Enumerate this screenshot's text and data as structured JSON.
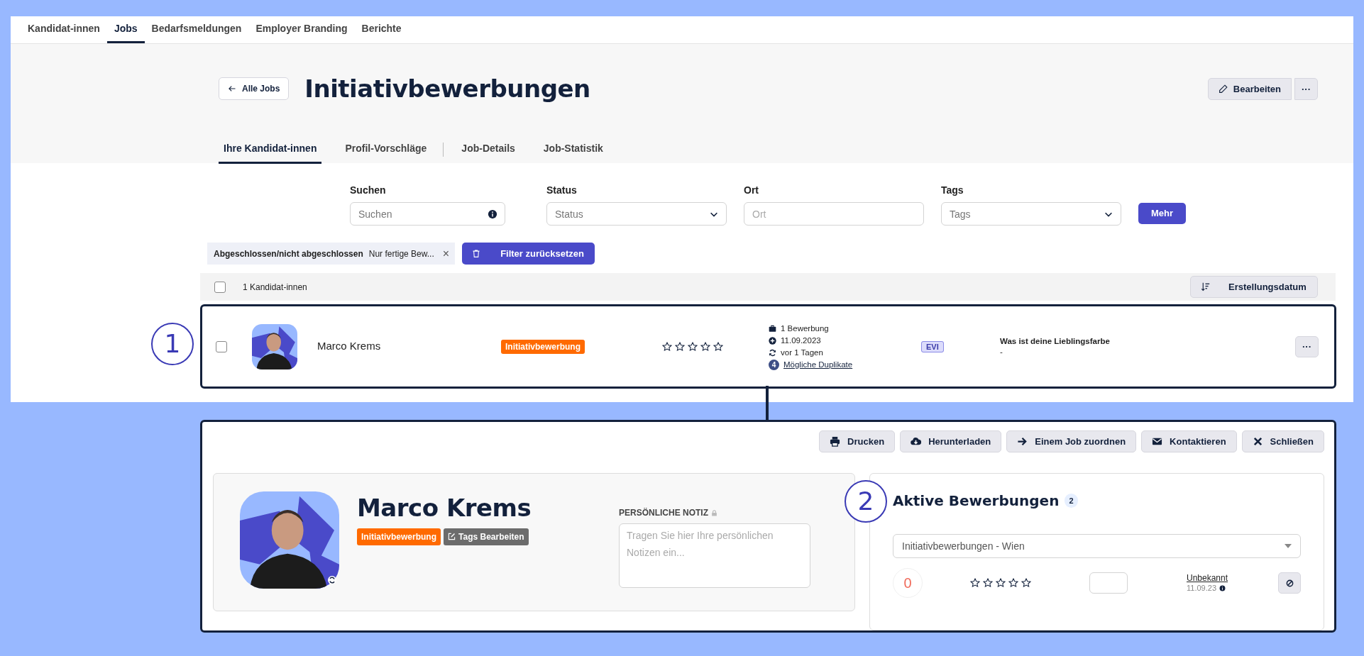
{
  "nav": [
    {
      "label": "Kandidat-innen",
      "selected": false
    },
    {
      "label": "Jobs",
      "selected": true
    },
    {
      "label": "Bedarfsmeldungen",
      "selected": false
    },
    {
      "label": "Employer Branding",
      "selected": false
    },
    {
      "label": "Berichte",
      "selected": false
    }
  ],
  "header": {
    "back_button": "Alle Jobs",
    "title": "Initiativbewerbungen",
    "edit_button": "Bearbeiten",
    "more_button": "···"
  },
  "tabs": [
    {
      "label": "Ihre Kandidat-innen",
      "selected": true
    },
    {
      "label": "Profil-Vorschläge",
      "selected": false
    },
    {
      "label": "Job-Details",
      "selected": false
    },
    {
      "label": "Job-Statistik",
      "selected": false
    }
  ],
  "filters": [
    {
      "label": "Suchen",
      "placeholder": "Suchen",
      "kind": "search"
    },
    {
      "label": "Status",
      "placeholder": "Status",
      "kind": "select"
    },
    {
      "label": "Ort",
      "placeholder": "Ort",
      "kind": "text"
    },
    {
      "label": "Tags",
      "placeholder": "Tags",
      "kind": "select"
    }
  ],
  "more_filters_button": "Mehr",
  "active_filter": {
    "name": "Abgeschlossen/nicht abgeschlossen",
    "value": "Nur fertige Bew...",
    "remove": "×"
  },
  "reset_button": "Filter zurücksetzen",
  "list": {
    "select_all_checked": false,
    "count": "1 Kandidat-innen",
    "sort_button": "Erstellungsdatum"
  },
  "candidates": [
    {
      "checked": false,
      "name": "Marco Krems",
      "tag": "Initiativbewerbung",
      "stars": 0,
      "applications": "1 Bewerbung",
      "created": "11.09.2023",
      "updated": "vor 1 Tagen",
      "duplicates_count": "4",
      "duplicates_link": "Mögliche Duplikate",
      "source": "EVI",
      "question": "Was ist deine Lieblingsfarbe",
      "answer": "-",
      "more_button": "···"
    }
  ],
  "annotations": [
    "1",
    "2"
  ],
  "detail": {
    "actions": [
      {
        "label": "Drucken",
        "kind": "print"
      },
      {
        "label": "Herunterladen",
        "kind": "download"
      },
      {
        "label": "Einem Job zuordnen",
        "kind": "assign"
      },
      {
        "label": "Kontaktieren",
        "kind": "contact"
      },
      {
        "label": "Schließen",
        "kind": "close"
      }
    ],
    "name": "Marco Krems",
    "tags": [
      {
        "label": "Initiativbewerbung",
        "kind": "tag"
      },
      {
        "label": "Tags Bearbeiten",
        "kind": "edit"
      }
    ],
    "note_label": "PERSÖNLICHE NOTIZ",
    "note_placeholder": "Tragen Sie hier Ihre persönlichen Notizen ein...",
    "applications": {
      "title": "Aktive Bewerbungen",
      "count": "2",
      "job": "Initiativbewerbungen - Wien",
      "score": "0",
      "stars": 0,
      "status": "Unbekannt",
      "date": "11.09.23"
    }
  }
}
